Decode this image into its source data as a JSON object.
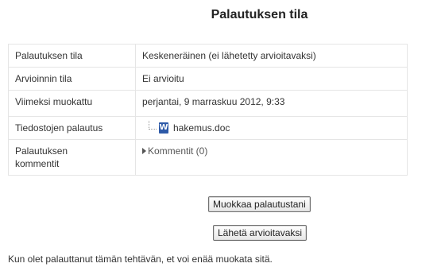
{
  "page": {
    "title": "Palautuksen tila"
  },
  "status_table": {
    "rows": [
      {
        "label": "Palautuksen tila",
        "value": "Keskeneräinen (ei lähetetty arvioitavaksi)"
      },
      {
        "label": "Arvioinnin tila",
        "value": "Ei arvioitu"
      },
      {
        "label": "Viimeksi muokattu",
        "value": "perjantai, 9 marraskuu 2012, 9:33"
      },
      {
        "label": "Tiedostojen palautus",
        "file": {
          "name": "hakemus.doc",
          "icon": "word-document-icon",
          "icon_glyph": "W"
        }
      },
      {
        "label_line1": "Palautuksen",
        "label_line2": "kommentit",
        "comments_toggle": "Kommentit (0)"
      }
    ]
  },
  "buttons": {
    "edit_label": "Muokkaa palautustani",
    "submit_label": "Lähetä arvioitavaksi"
  },
  "notice": "Kun olet palauttanut tämän tehtävän, et voi enää muokata sitä.",
  "colors": {
    "draft_highlight": "#efefd8",
    "grade_highlight": "#f2f2f2",
    "word_icon": "#2e5aa8"
  }
}
